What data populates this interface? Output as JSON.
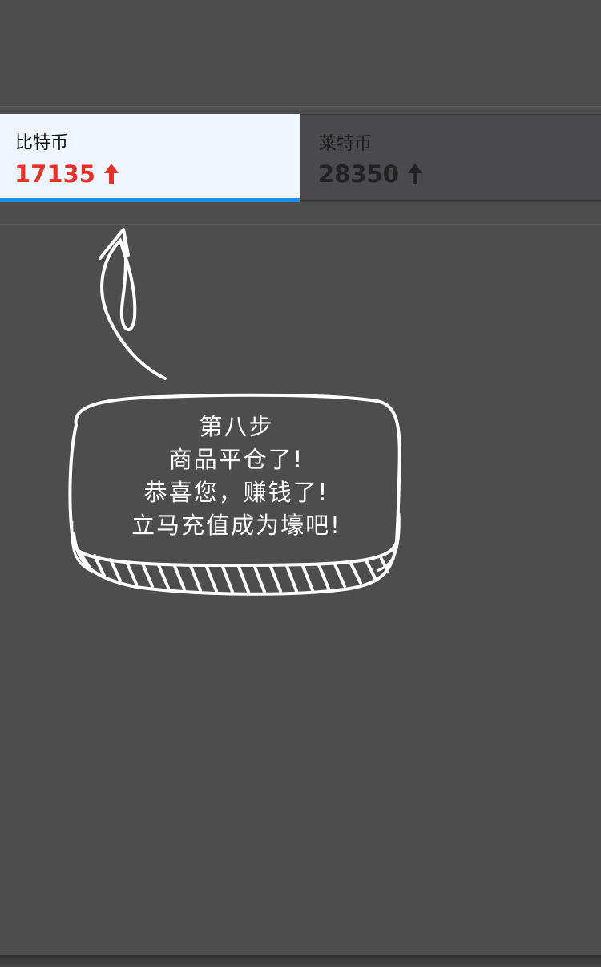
{
  "tabs": [
    {
      "name": "比特币",
      "price": "17135",
      "trend_icon": "arrow-up-icon",
      "color": "#e5332a",
      "active": true
    },
    {
      "name": "莱特币",
      "price": "28350",
      "trend_icon": "arrow-up-icon",
      "color": "#222222",
      "active": false
    }
  ],
  "tip": {
    "lines": [
      "第八步",
      "商品平仓了!",
      "恭喜您，赚钱了!",
      "立马充值成为壕吧!"
    ]
  },
  "colors": {
    "background": "#4d4d4d",
    "active_tab_bg": "#f0f6ff",
    "active_underline": "#1e8fe4",
    "price_up_red": "#e5332a"
  }
}
